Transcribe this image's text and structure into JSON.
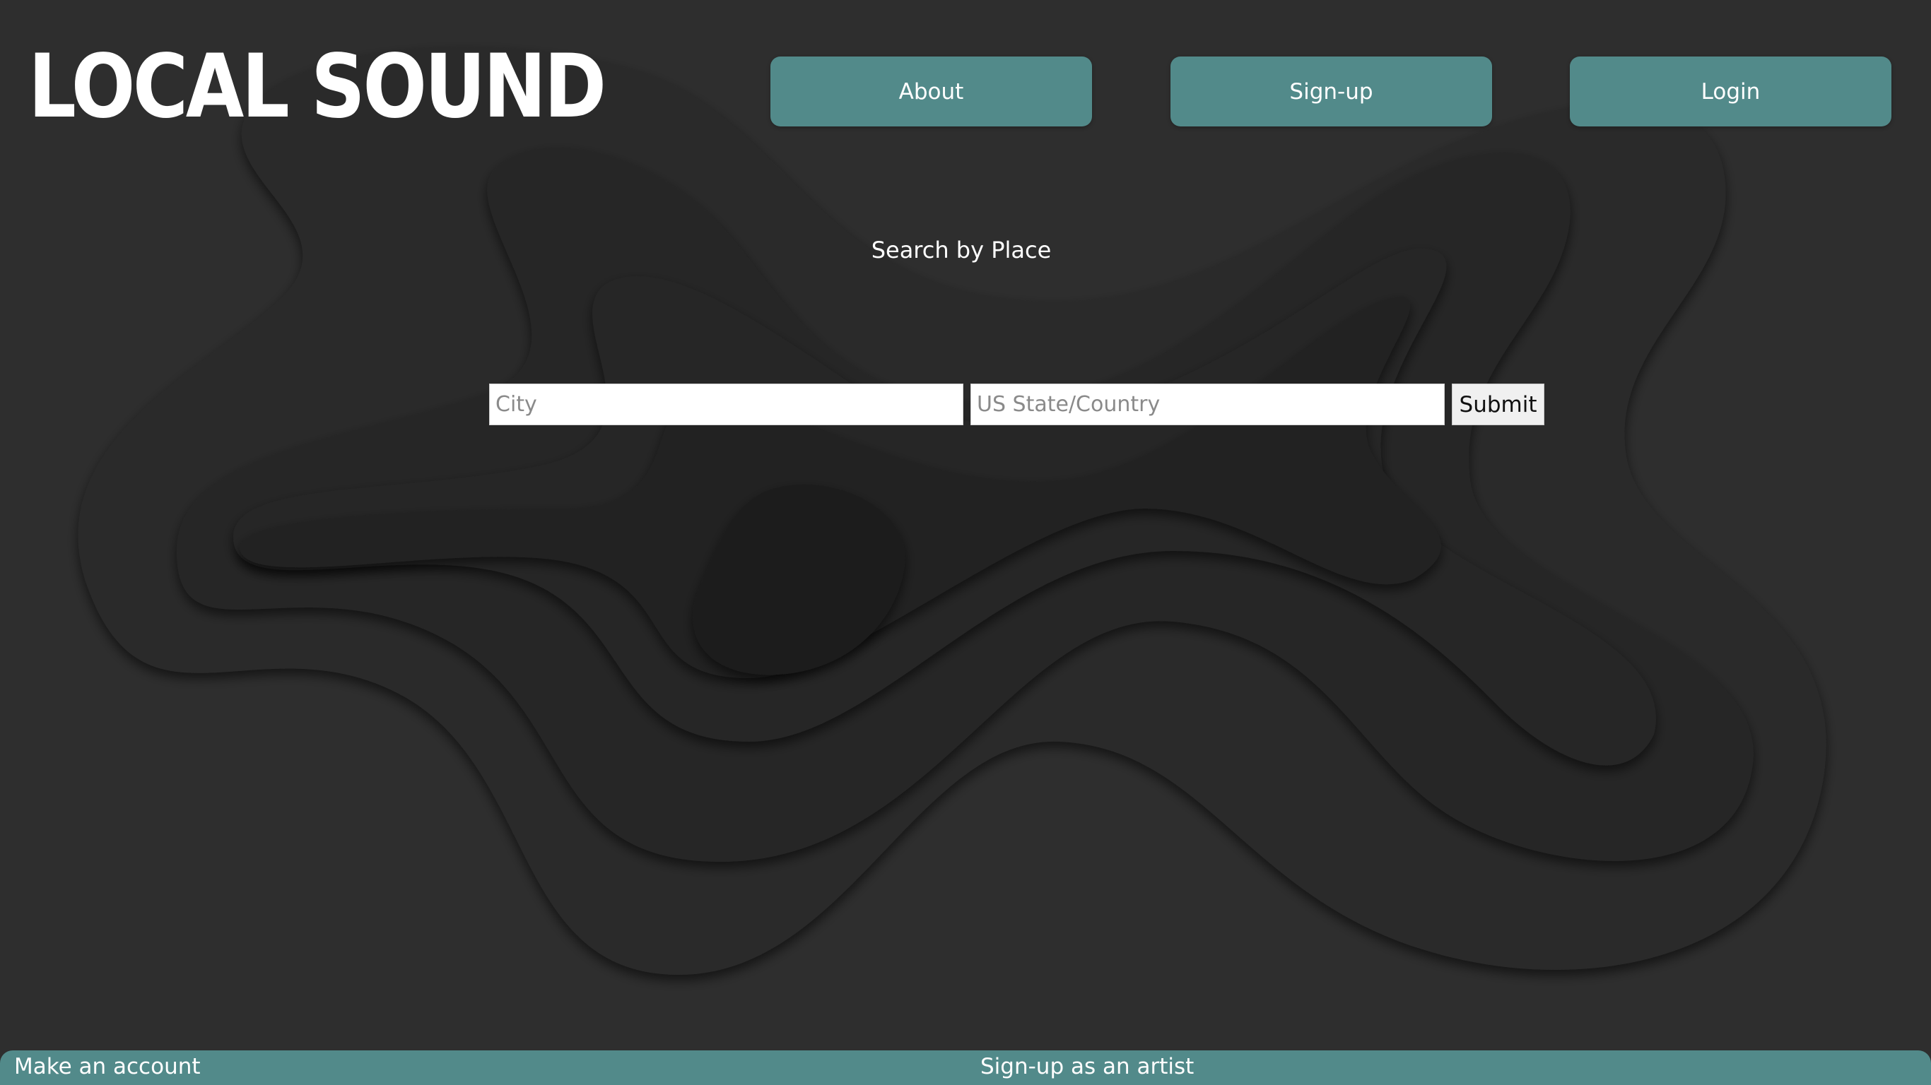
{
  "header": {
    "logo_text": "LOCAL SOUND",
    "nav": {
      "about_label": "About",
      "signup_label": "Sign-up",
      "login_label": "Login"
    }
  },
  "search": {
    "heading": "Search by Place",
    "city_placeholder": "City",
    "city_value": "",
    "region_placeholder": "US State/Country",
    "region_value": "",
    "submit_label": "Submit"
  },
  "footer": {
    "make_account_label": "Make an account",
    "artist_signup_label": "Sign-up as an artist"
  },
  "colors": {
    "background": "#2e2e2e",
    "accent": "#528a8a",
    "text": "#ffffff"
  }
}
